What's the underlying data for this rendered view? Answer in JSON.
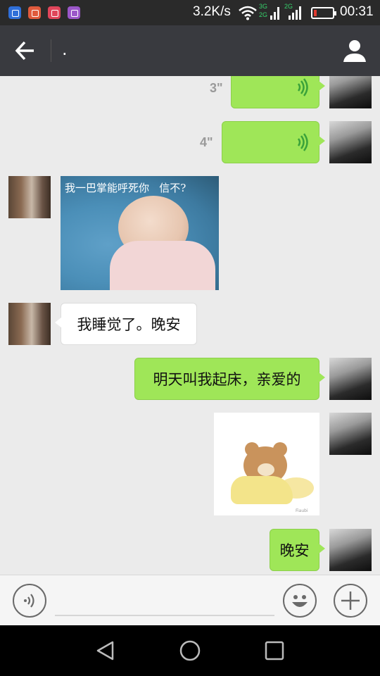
{
  "status_bar": {
    "net_speed": "3.2K/s",
    "net_type_1a": "3G",
    "net_type_1b": "2G",
    "net_type_2a": "2G",
    "time": "00:31",
    "battery_level": 0.15,
    "battery_color": "#e03a2f",
    "icons": [
      "shield-app-icon",
      "red-app-icon",
      "pink-app-icon",
      "purple-gallery-icon",
      "wifi-icon",
      "signal-icon",
      "signal-icon",
      "battery-icon"
    ]
  },
  "title_bar": {
    "title": ".",
    "back_icon": "arrow-left-icon",
    "contact_icon": "person-icon",
    "background": "#393a3f"
  },
  "messages": [
    {
      "from": "me",
      "type": "voice",
      "duration": "3\""
    },
    {
      "from": "me",
      "type": "voice",
      "duration": "4\""
    },
    {
      "from": "them",
      "type": "image",
      "caption": "我一巴掌能呼死你   信不?"
    },
    {
      "from": "them",
      "type": "text",
      "text": "我睡觉了。晚安"
    },
    {
      "from": "me",
      "type": "text",
      "text": "明天叫我起床，亲爱的"
    },
    {
      "from": "me",
      "type": "sticker",
      "sticker_label": "Fiaubi"
    },
    {
      "from": "me",
      "type": "text",
      "text": "晚安"
    }
  ],
  "colors": {
    "my_bubble": "#9fe658",
    "their_bubble": "#ffffff",
    "chat_background": "#ebebeb"
  },
  "input_bar": {
    "value": "",
    "placeholder": "",
    "voice_icon": "voice-icon",
    "emoji_icon": "smiley-icon",
    "plus_icon": "plus-icon"
  },
  "nav_bar": {
    "icons": [
      "back-triangle-icon",
      "home-circle-icon",
      "recents-square-icon"
    ]
  }
}
